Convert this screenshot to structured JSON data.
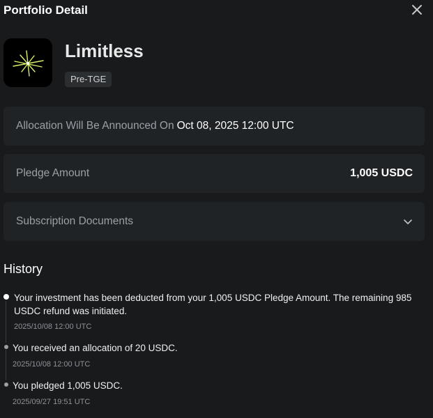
{
  "header": {
    "title": "Portfolio Detail"
  },
  "project": {
    "name": "Limitless",
    "badge": "Pre-TGE"
  },
  "allocation": {
    "label": "Allocation Will Be Announced On",
    "date": "Oct 08, 2025 12:00 UTC"
  },
  "pledge": {
    "label": "Pledge Amount",
    "value": "1,005 USDC"
  },
  "documents": {
    "label": "Subscription Documents"
  },
  "history": {
    "title": "History",
    "items": [
      {
        "text": "Your investment has been deducted from your 1,005 USDC Pledge Amount. The remaining 985 USDC refund was initiated.",
        "date": "2025/10/08 12:00 UTC"
      },
      {
        "text": "You received an allocation of 20 USDC.",
        "date": "2025/10/08 12:00 UTC"
      },
      {
        "text": "You pledged 1,005 USDC.",
        "date": "2025/09/27 19:51 UTC"
      }
    ]
  },
  "colors": {
    "background": "#181a1c",
    "card": "#1f2326",
    "muted": "#9aa0a6",
    "accent_logo": "#d9f26b"
  },
  "icons": {
    "close": "close-icon",
    "chevron": "chevron-down-icon",
    "logo": "limitless-logo-icon"
  }
}
